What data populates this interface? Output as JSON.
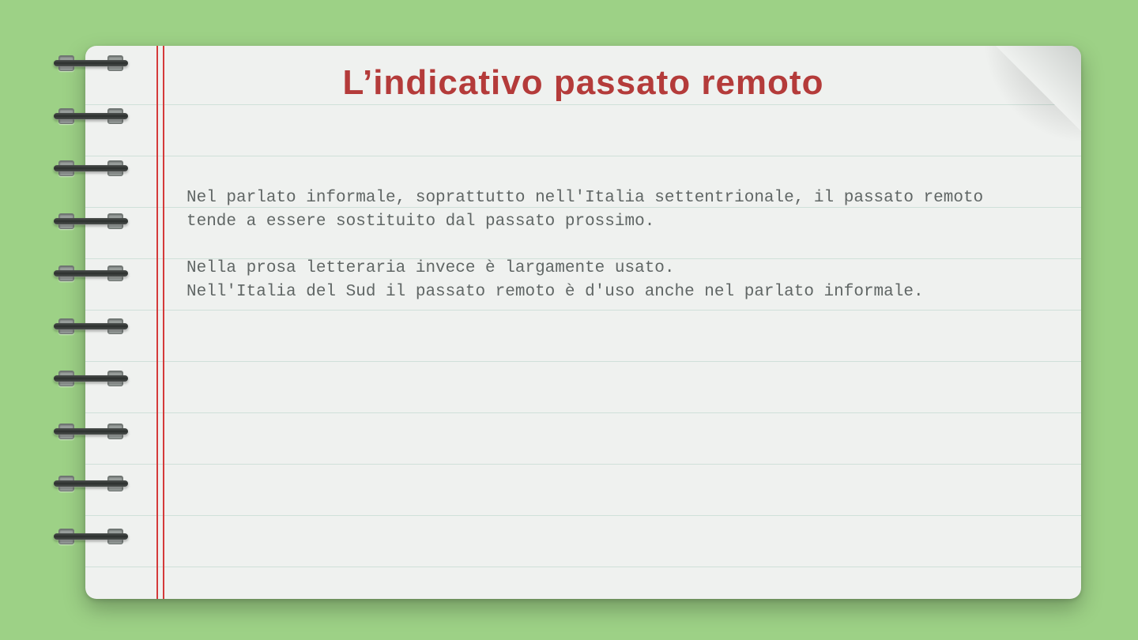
{
  "title": "L’indicativo passato remoto",
  "paragraphs": {
    "p1": "Nel parlato informale, soprattutto nell'Italia settentrionale, il passato remoto tende a essere sostituito dal passato prossimo.",
    "p2": "Nella prosa letteraria invece è largamente usato.\nNell'Italia del Sud il passato remoto è d'uso anche nel parlato informale."
  },
  "rings_count": 10,
  "colors": {
    "background": "#9dd186",
    "title": "#b43b3a",
    "margin_line": "#d43a3a",
    "rule_line": "#cfe0d9",
    "paper": "#eff1ef",
    "body_text": "#606665"
  }
}
